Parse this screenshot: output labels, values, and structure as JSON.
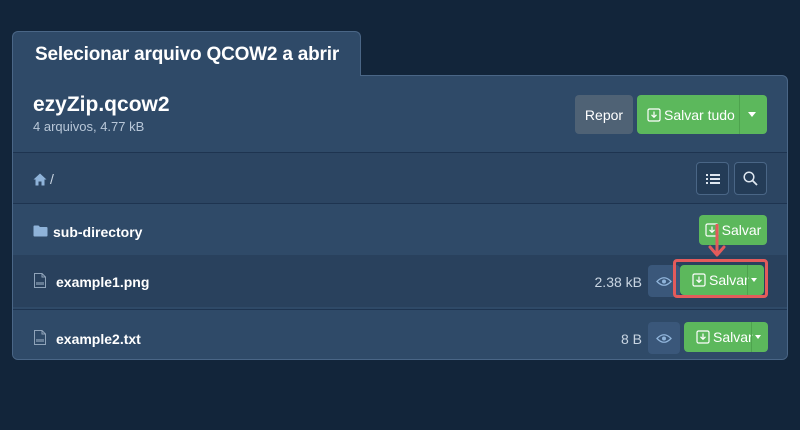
{
  "dialog": {
    "title": "Selecionar arquivo QCOW2 a abrir"
  },
  "archive": {
    "name": "ezyZip.qcow2",
    "info": "4 arquivos, 4.77 kB"
  },
  "toolbar": {
    "reset_label": "Repor",
    "save_all_label": "Salvar tudo"
  },
  "breadcrumb": {
    "path": "/"
  },
  "files": [
    {
      "name": "sub-directory",
      "type": "folder",
      "size": "",
      "save_label": "Salvar"
    },
    {
      "name": "example1.png",
      "type": "image",
      "size": "2.38 kB",
      "save_label": "Salvar"
    },
    {
      "name": "example2.txt",
      "type": "text",
      "size": "8 B",
      "save_label": "Salvar"
    }
  ],
  "icons": {
    "home": "home-icon",
    "list": "list-icon",
    "search": "search-icon",
    "folder": "folder-icon",
    "file": "file-icon",
    "eye": "eye-icon",
    "download": "download-icon",
    "caret": "caret-down-icon"
  },
  "colors": {
    "background": "#12253a",
    "panel": "#2f4a68",
    "save_green": "#5cb85c",
    "reset_gray": "#4f6275",
    "highlight_red": "#e35b5b"
  }
}
